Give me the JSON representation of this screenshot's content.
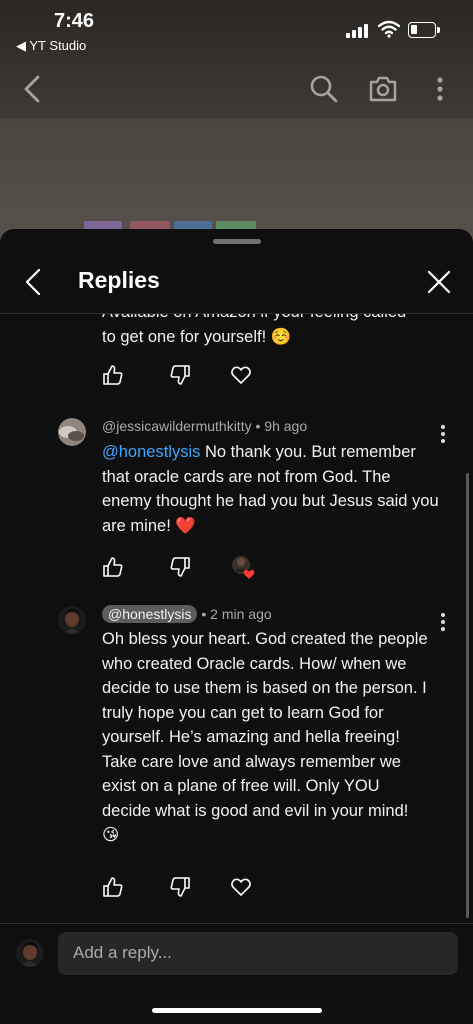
{
  "status_bar": {
    "time": "7:46",
    "back_app": "◀ YT Studio"
  },
  "top_nav": {
    "icons": [
      "back-arrow-icon",
      "search-icon",
      "camera-icon",
      "more-vert-icon"
    ]
  },
  "sheet": {
    "title": "Replies",
    "previous_comment": {
      "cut_text": "Available on Amazon if your feeling called",
      "text": "to get one for yourself! ☺️"
    },
    "replies": [
      {
        "author": "@jessicawildermuthkitty",
        "time": "9h ago",
        "mention": "@honestlysis",
        "text": "No thank you. But remember that oracle cards are not from God. The enemy thought he had you but Jesus said you are mine! ❤️",
        "hearted": true
      },
      {
        "author": "@honestlysis",
        "time": "2 min ago",
        "text": "Oh bless your heart. God created the people who created Oracle cards. How/ when we decide to use them is based on the person. I truly hope you can get to learn God for yourself. He’s amazing and hella freeing! Take care love and always remember we exist on a plane of free will. Only YOU decide what is good and evil in your mind! 😘",
        "is_creator": true
      }
    ],
    "separator": "•",
    "reply_placeholder": "Add a reply..."
  },
  "colors": {
    "background": "#0f0f0f",
    "mention": "#3ea6ff",
    "input_bg": "#272727",
    "heart": "#ff3b3b"
  }
}
